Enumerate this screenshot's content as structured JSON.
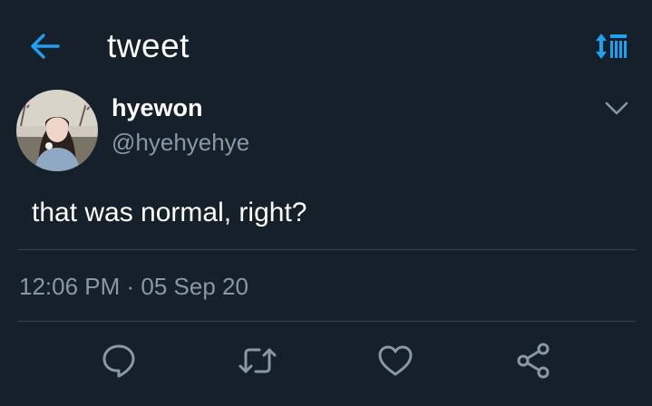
{
  "header": {
    "title": "tweet",
    "back_icon": "arrow-left-icon",
    "sort_icon": "sort-list-icon"
  },
  "tweet": {
    "author": {
      "name": "hyewon",
      "handle": "@hyehyehye"
    },
    "text": "that was normal, right?",
    "timestamp": "12:06 PM · 05 Sep 20"
  },
  "actions": [
    {
      "icon": "reply-icon"
    },
    {
      "icon": "retweet-icon"
    },
    {
      "icon": "like-icon"
    },
    {
      "icon": "share-icon"
    }
  ],
  "colors": {
    "background": "#15202b",
    "accent": "#1da1f2",
    "secondary_text": "#8899a6",
    "divider": "#38444d"
  }
}
